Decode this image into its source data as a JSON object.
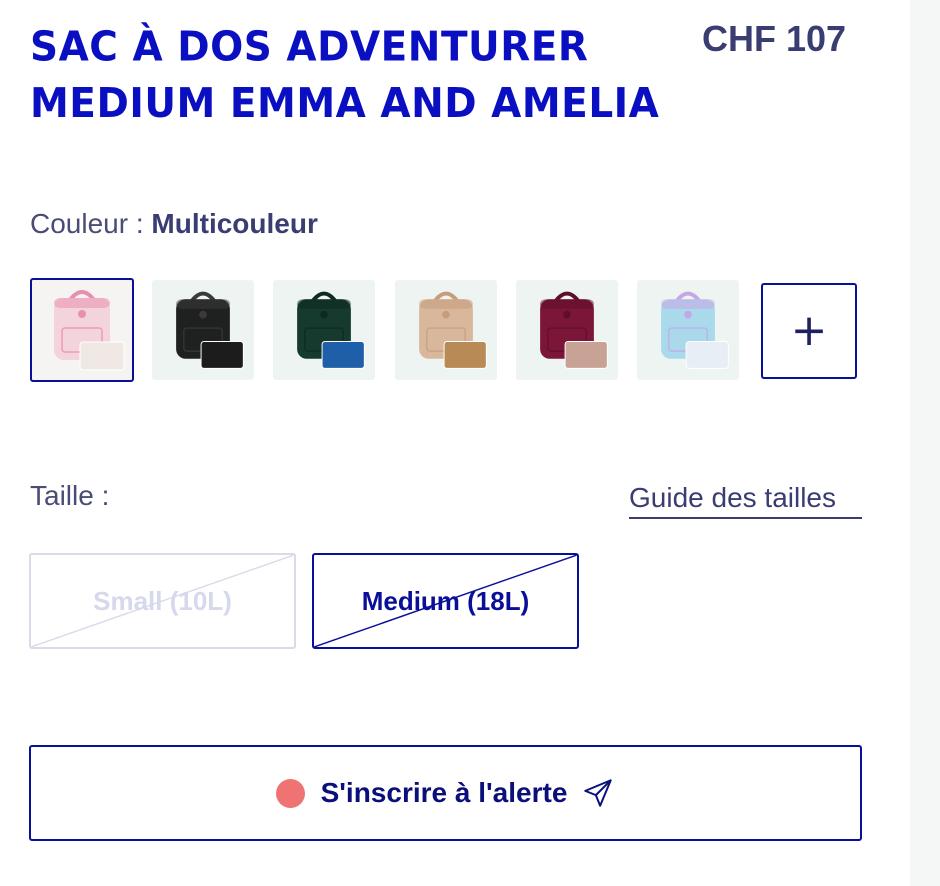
{
  "product": {
    "title_line1": "Sac à dos Adventurer",
    "title_line2": "Medium Emma and Amelia",
    "price": "CHF 107"
  },
  "color": {
    "label": "Couleur :",
    "selected": "Multicouleur",
    "swatches": [
      {
        "name": "multicolor-floral",
        "bag": "#f3d3dc",
        "accent": "#e98fae",
        "pouch": "#efe8e4",
        "selected": true
      },
      {
        "name": "black",
        "bag": "#1f2121",
        "accent": "#3a3a3a",
        "pouch": "#1c1c1c",
        "selected": false
      },
      {
        "name": "dark-green",
        "bag": "#173a2e",
        "accent": "#0d2a20",
        "pouch": "#1f5ea8",
        "selected": false
      },
      {
        "name": "beige",
        "bag": "#d9b79c",
        "accent": "#c59d7d",
        "pouch": "#b88a55",
        "selected": false
      },
      {
        "name": "burgundy",
        "bag": "#7c1638",
        "accent": "#5e0f28",
        "pouch": "#c9a296",
        "selected": false
      },
      {
        "name": "pastel-gradient",
        "bag": "#a9d9ea",
        "accent": "#c6a6e6",
        "pouch": "#e7eef6",
        "selected": false
      }
    ],
    "more_symbol": "+"
  },
  "size": {
    "label": "Taille :",
    "guide_link": "Guide des tailles",
    "options": [
      {
        "label": "Small (10L)",
        "available": false,
        "selected": false
      },
      {
        "label": "Medium (18L)",
        "available": false,
        "selected": true
      }
    ]
  },
  "alert": {
    "label": "S'inscrire à l'alerte",
    "dot_color": "#f07373",
    "icon": "send-icon"
  },
  "colors": {
    "brand_blue": "#0a0fc2",
    "text_navy": "#3a3d72",
    "border_blue": "#0a0f9a"
  }
}
